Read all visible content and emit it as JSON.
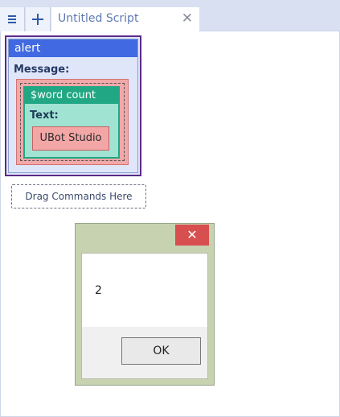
{
  "tabs": {
    "menu_icon": "hamburger-menu-icon",
    "add_icon": "plus-icon",
    "active_tab": {
      "label": "Untitled Script",
      "close_icon": "close-icon"
    }
  },
  "command": {
    "name": "alert",
    "param_label": "Message:",
    "function": {
      "name": "$word count",
      "param_label": "Text:",
      "value": "UBot Studio"
    }
  },
  "drop_zone": {
    "label": "Drag Commands Here"
  },
  "dialog": {
    "close_icon": "close-icon",
    "message": "2",
    "ok_label": "OK"
  },
  "colors": {
    "alert_header": "#4169e1",
    "function_header": "#21a783",
    "dialog_close": "#d84f4f"
  }
}
